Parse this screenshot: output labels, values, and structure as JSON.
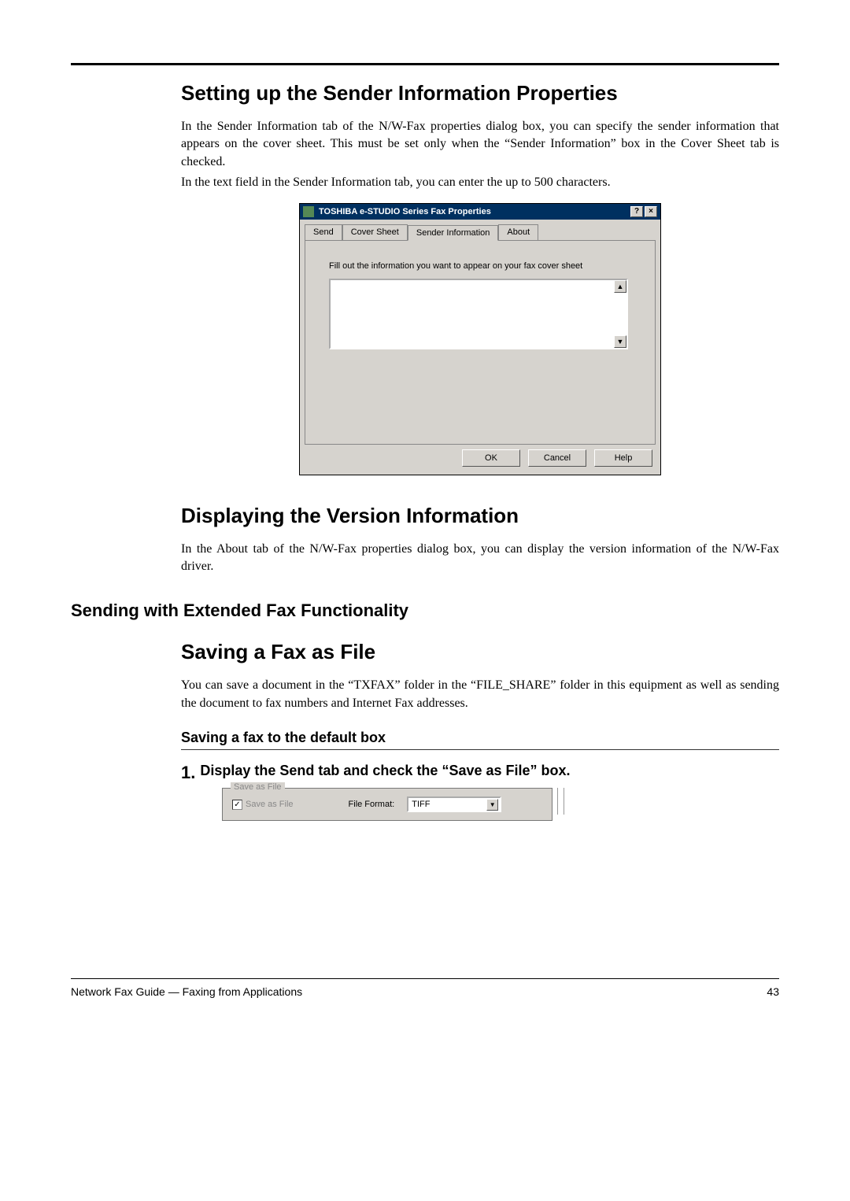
{
  "heading1": "Setting up the Sender Information Properties",
  "para1a": "In the Sender Information tab of the N/W-Fax properties dialog box, you can specify the sender information that appears on the cover sheet.  This must be set only when the “Sender Information” box in the Cover Sheet tab is checked.",
  "para1b": "In the text field in the Sender Information tab, you can enter the up to 500 characters.",
  "dialog1": {
    "title": "TOSHIBA e-STUDIO Series Fax Properties",
    "help_glyph": "?",
    "close_glyph": "×",
    "tabs": [
      "Send",
      "Cover Sheet",
      "Sender Information",
      "About"
    ],
    "instruction": "Fill out the information you want to appear on your fax cover sheet",
    "sender_text": "",
    "scroll_up": "▲",
    "scroll_down": "▼",
    "ok": "OK",
    "cancel": "Cancel",
    "help": "Help"
  },
  "heading2": "Displaying the Version Information",
  "para2": "In the About tab of the N/W-Fax properties dialog box, you can display the version information of the N/W-Fax driver.",
  "heading3": "Sending with Extended Fax Functionality",
  "heading4": "Saving a Fax as File",
  "para3": "You can save a document in the “TXFAX” folder in the “FILE_SHARE” folder in this equipment as well as sending the document to fax numbers and Internet Fax addresses.",
  "subheading": "Saving a fax to the default box",
  "step1_num": "1.",
  "step1_text": "Display the Send tab and check the “Save as File” box.",
  "dialog2": {
    "group_title": "Save as File",
    "check_mark": "✓",
    "checkbox_label": "Save as File",
    "file_format_label": "File Format:",
    "select_value": "TIFF",
    "select_glyph": "▼"
  },
  "footer_left": "Network Fax Guide — Faxing from Applications",
  "footer_right": "43"
}
